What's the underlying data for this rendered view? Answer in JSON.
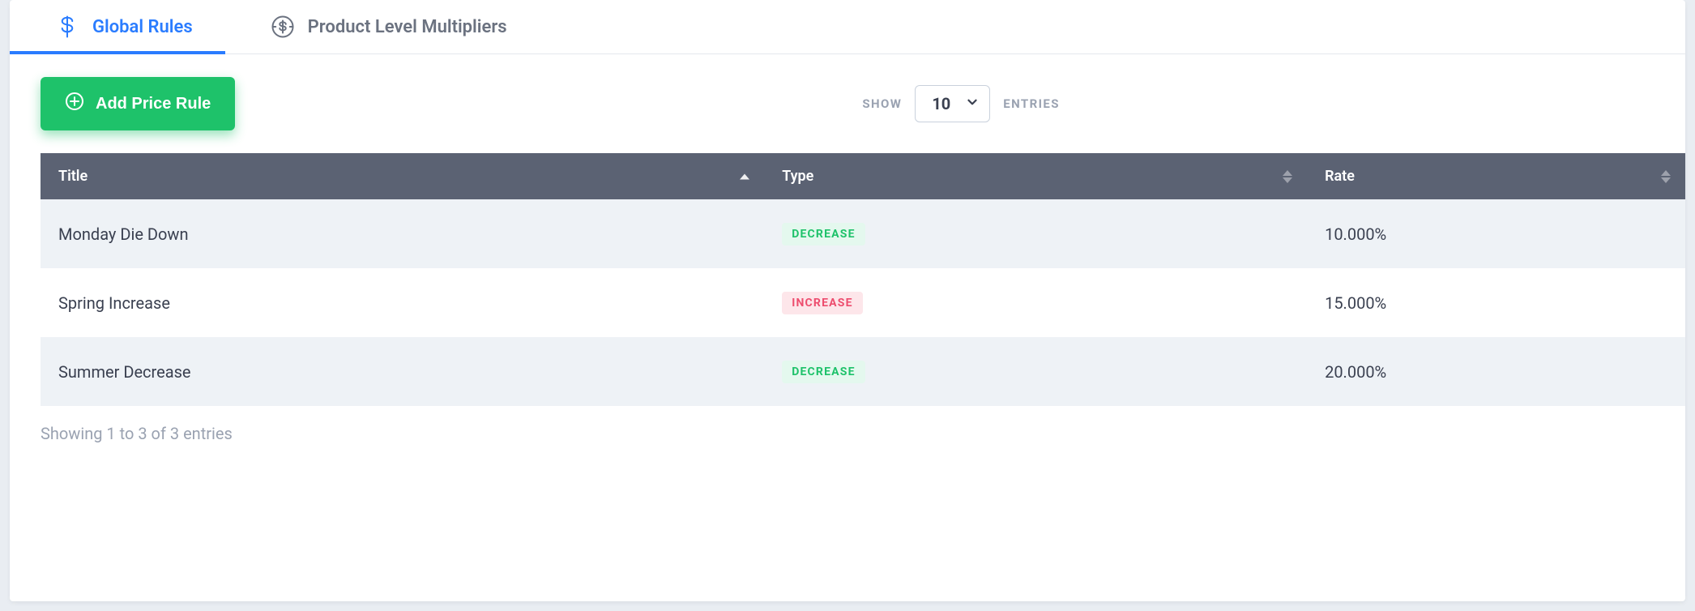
{
  "tabs": [
    {
      "label": "Global Rules",
      "active": true
    },
    {
      "label": "Product Level Multipliers",
      "active": false
    }
  ],
  "toolbar": {
    "add_label": "Add Price Rule"
  },
  "length": {
    "show_label": "SHOW",
    "entries_label": "ENTRIES",
    "selected": "10"
  },
  "columns": {
    "title": "Title",
    "type": "Type",
    "rate": "Rate"
  },
  "rows": [
    {
      "title": "Monday Die Down",
      "type_label": "DECREASE",
      "type_kind": "decrease",
      "rate": "10.000%"
    },
    {
      "title": "Spring Increase",
      "type_label": "INCREASE",
      "type_kind": "increase",
      "rate": "15.000%"
    },
    {
      "title": "Summer Decrease",
      "type_label": "DECREASE",
      "type_kind": "decrease",
      "rate": "20.000%"
    }
  ],
  "footer": {
    "info": "Showing 1 to 3 of 3 entries"
  }
}
